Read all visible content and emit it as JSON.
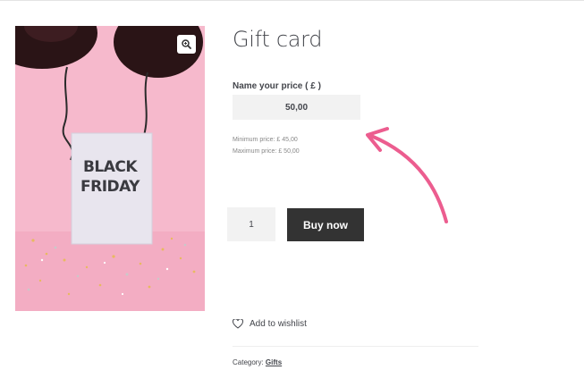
{
  "product": {
    "title": "Gift card",
    "image_card_line1": "BLACK",
    "image_card_line2": "FRIDAY",
    "zoom_icon": "magnify-plus-icon"
  },
  "price_form": {
    "label": "Name your price ( £ )",
    "value": "50,00",
    "min_hint": "Minimum price: £ 45,00",
    "max_hint": "Maximum price: £ 50,00"
  },
  "cart": {
    "quantity": "1",
    "buy_label": "Buy now"
  },
  "wishlist": {
    "label": "Add to wishlist",
    "icon": "heart-icon"
  },
  "meta": {
    "category_label": "Category:",
    "category_link": "Gifts"
  },
  "colors": {
    "accent_arrow": "#ec5d8f",
    "button_bg": "#333333",
    "image_bg": "#f6b9cc"
  }
}
